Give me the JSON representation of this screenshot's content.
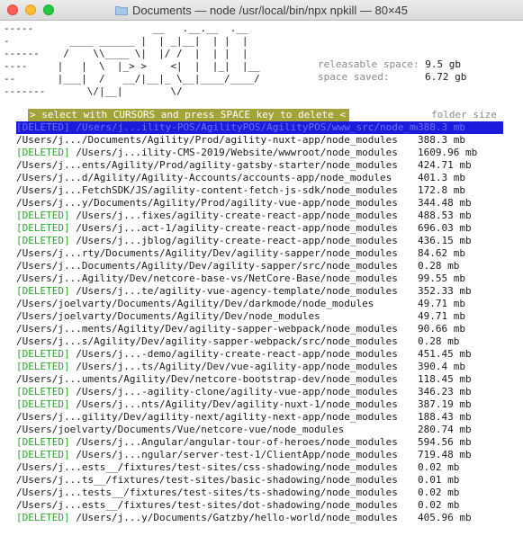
{
  "window": {
    "title": "Documents — node /usr/local/bin/npx npkill — 80×45",
    "folder_icon": "folder-icon"
  },
  "banner_lines": [
    "-----                    __   .__.__  .__",
    "-          ____ ______ |  | _|__|  | |  |",
    "------    /    \\\\____ \\|  |/ /  |  | |  |",
    "----     |   |  \\  |_> >    <|  |  |_|  |__",
    "--       |___|  /   __/|__|_ \\__|____/____/",
    "-------       \\/|__|        \\/"
  ],
  "stats": {
    "releasable_label": "releasable space:",
    "releasable_value": "9.5 gb",
    "saved_label": "space saved:",
    "saved_value": "6.72 gb"
  },
  "prompt": "> select with CURSORS and press SPACE key to delete <",
  "column_header": "folder size",
  "rows": [
    {
      "status": "[DELETED]",
      "path": " /Users/j...ility-POS/AgilityPOS/AgilityPOS/www_src/node_modules",
      "size": "388.3 mb",
      "selected": true
    },
    {
      "status": "",
      "path": "/Users/j.../Documents/Agility/Prod/agility-nuxt-app/node_modules",
      "size": "388.3 mb"
    },
    {
      "status": "[DELETED]",
      "path": " /Users/j...ility-CMS-2019/Website/wwwroot/node_modules",
      "size": "1609.96 mb"
    },
    {
      "status": "",
      "path": "/Users/j...ents/Agility/Prod/agility-gatsby-starter/node_modules",
      "size": "424.71 mb"
    },
    {
      "status": "",
      "path": "/Users/j...d/Agility/Agility-Accounts/accounts-app/node_modules",
      "size": "401.3 mb"
    },
    {
      "status": "",
      "path": "/Users/j...FetchSDK/JS/agility-content-fetch-js-sdk/node_modules",
      "size": "172.8 mb"
    },
    {
      "status": "",
      "path": "/Users/j...y/Documents/Agility/Prod/agility-vue-app/node_modules",
      "size": "344.48 mb"
    },
    {
      "status": "[DELETED]",
      "path": " /Users/j...fixes/agility-create-react-app/node_modules",
      "size": "488.53 mb"
    },
    {
      "status": "[DELETED]",
      "path": " /Users/j...act-1/agility-create-react-app/node_modules",
      "size": "696.03 mb"
    },
    {
      "status": "[DELETED]",
      "path": " /Users/j...jblog/agility-create-react-app/node_modules",
      "size": "436.15 mb"
    },
    {
      "status": "",
      "path": "/Users/j...rty/Documents/Agility/Dev/agility-sapper/node_modules",
      "size": "84.62 mb"
    },
    {
      "status": "",
      "path": "/Users/j...Documents/Agility/Dev/agility-sapper/src/node_modules",
      "size": "0.28 mb"
    },
    {
      "status": "",
      "path": "/Users/j...Agility/Dev/netcore-base-vs/NetCore-Base/node_modules",
      "size": "99.55 mb"
    },
    {
      "status": "[DELETED]",
      "path": " /Users/j...te/agility-vue-agency-template/node_modules",
      "size": "352.33 mb"
    },
    {
      "status": "",
      "path": "/Users/joelvarty/Documents/Agility/Dev/darkmode/node_modules",
      "size": "49.71 mb"
    },
    {
      "status": "",
      "path": "/Users/joelvarty/Documents/Agility/Dev/node_modules",
      "size": "49.71 mb"
    },
    {
      "status": "",
      "path": "/Users/j...ments/Agility/Dev/agility-sapper-webpack/node_modules",
      "size": "90.66 mb"
    },
    {
      "status": "",
      "path": "/Users/j...s/Agility/Dev/agility-sapper-webpack/src/node_modules",
      "size": "0.28 mb"
    },
    {
      "status": "[DELETED]",
      "path": " /Users/j...-demo/agility-create-react-app/node_modules",
      "size": "451.45 mb"
    },
    {
      "status": "[DELETED]",
      "path": " /Users/j...ts/Agility/Dev/vue-agility-app/node_modules",
      "size": "390.4 mb"
    },
    {
      "status": "",
      "path": "/Users/j...uments/Agility/Dev/netcore-bootstrap-dev/node_modules",
      "size": "118.45 mb"
    },
    {
      "status": "[DELETED]",
      "path": " /Users/j...-agility-clone/agility-vue-app/node_modules",
      "size": "346.23 mb"
    },
    {
      "status": "[DELETED]",
      "path": " /Users/j...nts/Agility/Dev/agility-nuxt-1/node_modules",
      "size": "387.19 mb"
    },
    {
      "status": "",
      "path": "/Users/j...gility/Dev/agility-next/agility-next-app/node_modules",
      "size": "188.43 mb"
    },
    {
      "status": "",
      "path": "/Users/joelvarty/Documents/Vue/netcore-vue/node_modules",
      "size": "280.74 mb"
    },
    {
      "status": "[DELETED]",
      "path": " /Users/j...Angular/angular-tour-of-heroes/node_modules",
      "size": "594.56 mb"
    },
    {
      "status": "[DELETED]",
      "path": " /Users/j...ngular/server-test-1/ClientApp/node_modules",
      "size": "719.48 mb"
    },
    {
      "status": "",
      "path": "/Users/j...ests__/fixtures/test-sites/css-shadowing/node_modules",
      "size": "0.02 mb"
    },
    {
      "status": "",
      "path": "/Users/j...ts__/fixtures/test-sites/basic-shadowing/node_modules",
      "size": "0.01 mb"
    },
    {
      "status": "",
      "path": "/Users/j...tests__/fixtures/test-sites/ts-shadowing/node_modules",
      "size": "0.02 mb"
    },
    {
      "status": "",
      "path": "/Users/j...ests__/fixtures/test-sites/dot-shadowing/node_modules",
      "size": "0.02 mb"
    },
    {
      "status": "[DELETED]",
      "path": " /Users/j...y/Documents/Gatzby/hello-world/node_modules",
      "size": "405.96 mb"
    }
  ],
  "colors": {
    "deleted": "#2aa52a",
    "prompt_bg": "#a3a33b",
    "selected_bg": "#1b1bdb",
    "dim": "#8a8a8a"
  }
}
